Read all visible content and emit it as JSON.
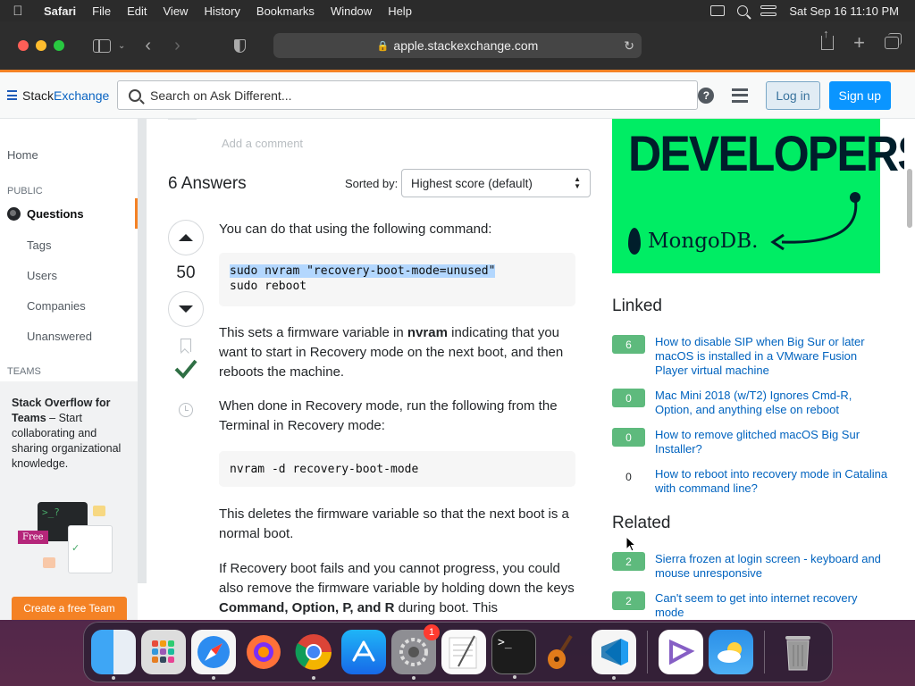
{
  "menubar": {
    "app_name": "Safari",
    "items": [
      "File",
      "Edit",
      "View",
      "History",
      "Bookmarks",
      "Window",
      "Help"
    ],
    "datetime": "Sat Sep 16  11:10 PM"
  },
  "browser": {
    "url": "apple.stackexchange.com",
    "traffic_light_colors": [
      "#fe5f57",
      "#febc2e",
      "#28c840"
    ]
  },
  "site_header": {
    "logo_stack": "Stack",
    "logo_exchange": "Exchange",
    "search_placeholder": "Search on Ask Different...",
    "help_icon": "?",
    "login_label": "Log in",
    "signup_label": "Sign up",
    "accent_color": "#f48225"
  },
  "left_nav": {
    "home": "Home",
    "public_heading": "PUBLIC",
    "questions": "Questions",
    "tags": "Tags",
    "users": "Users",
    "companies": "Companies",
    "unanswered": "Unanswered",
    "teams_heading": "TEAMS",
    "teams_title": "Stack Overflow for Teams",
    "teams_desc": " – Start collaborating and sharing organizational knowledge.",
    "teams_free_label": "Free",
    "teams_term_prompt": ">_?",
    "create_team_label": "Create a free Team"
  },
  "main": {
    "add_comment": "Add a comment",
    "answers_title": "6 Answers",
    "sorted_by_label": "Sorted by:",
    "sort_value": "Highest score (default)",
    "answer": {
      "score": "50",
      "intro": "You can do that using the following command:",
      "code1_line1": "sudo nvram \"recovery-boot-mode=unused\"",
      "code1_line2": "sudo reboot",
      "para1_a": "This sets a firmware variable in ",
      "para1_b": "nvram",
      "para1_c": " indicating that you want to start in Recovery mode on the next boot, and then reboots the machine.",
      "para2": "When done in Recovery mode, run the following from the Terminal in Recovery mode:",
      "code2": "nvram -d recovery-boot-mode",
      "para3": "This deletes the firmware variable so that the next boot is a normal boot.",
      "para4_a": "If Recovery boot fails and you cannot progress, you could also remove the firmware variable by holding down the keys ",
      "para4_b": "Command, Option, P, and R",
      "para4_c": " during boot. This"
    }
  },
  "sidebar": {
    "ad_headline": "DEVELOPERS.",
    "ad_brand": "MongoDB.",
    "linked_title": "Linked",
    "linked": [
      {
        "count": "6",
        "title": "How to disable SIP when Big Sur or later macOS is installed in a VMware Fusion Player virtual machine",
        "accepted": true
      },
      {
        "count": "0",
        "title": "Mac Mini 2018 (w/T2) Ignores Cmd-R, Option, and anything else on reboot",
        "accepted": true
      },
      {
        "count": "0",
        "title": "How to remove glitched macOS Big Sur Installer?",
        "accepted": true
      },
      {
        "count": "0",
        "title": "How to reboot into recovery mode in Catalina with command line?",
        "accepted": false
      }
    ],
    "related_title": "Related",
    "related": [
      {
        "count": "2",
        "title": "Sierra frozen at login screen - keyboard and mouse unresponsive"
      },
      {
        "count": "2",
        "title": "Can't seem to get into internet recovery mode"
      }
    ]
  },
  "dock": {
    "apps": [
      "finder-icon",
      "launchpad-icon",
      "safari-icon",
      "firefox-icon",
      "chrome-icon",
      "app-store-icon",
      "system-preferences-icon",
      "textedit-icon",
      "terminal-icon",
      "garageband-icon",
      "vscode-icon",
      "visual-studio-icon",
      "weather-icon",
      "trash-icon"
    ],
    "settings_badge": "1"
  }
}
